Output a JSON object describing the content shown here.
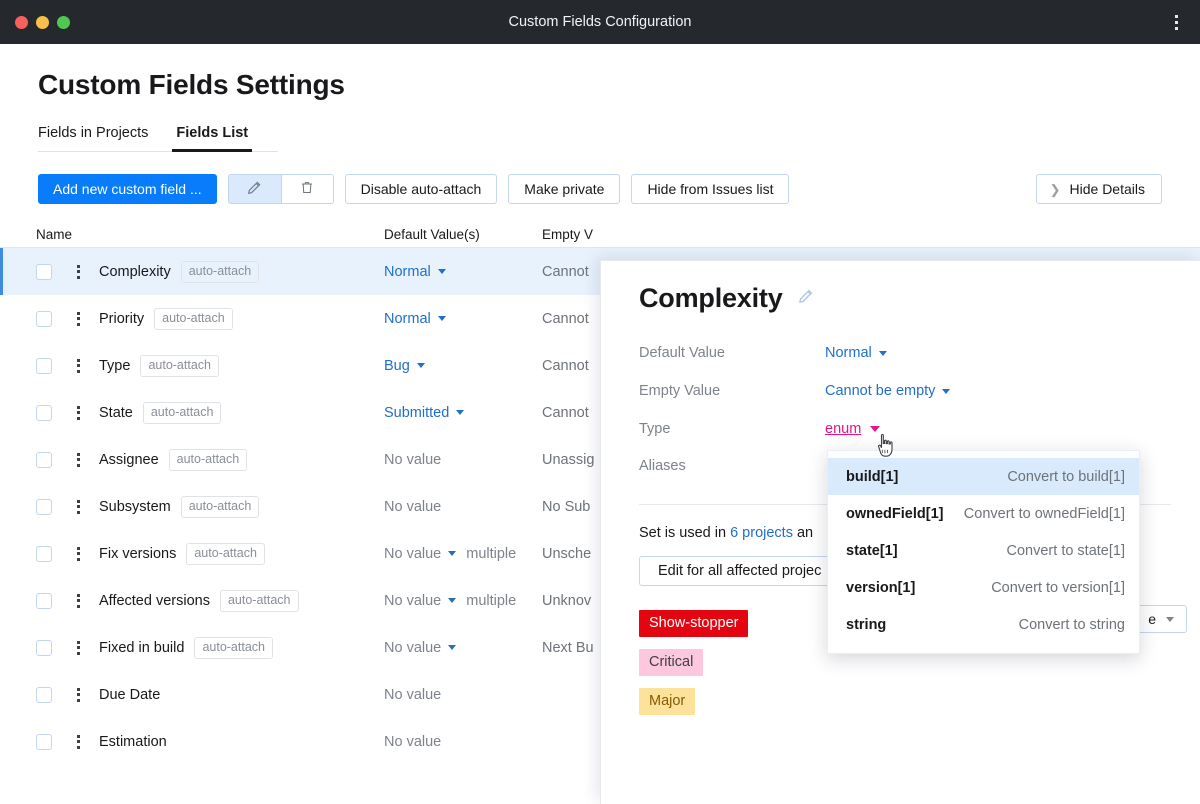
{
  "window": {
    "title": "Custom Fields Configuration",
    "menu_icon": "kebab-menu-icon"
  },
  "page": {
    "title": "Custom Fields Settings"
  },
  "tabs": [
    {
      "label": "Fields in Projects",
      "active": false
    },
    {
      "label": "Fields List",
      "active": true
    }
  ],
  "toolbar": {
    "add_label": "Add new custom field ...",
    "edit_icon": "pencil-icon",
    "delete_icon": "trash-icon",
    "disable_auto_attach_label": "Disable auto-attach",
    "make_private_label": "Make private",
    "hide_from_issues_label": "Hide from Issues list",
    "hide_details_label": "Hide Details",
    "hide_details_chevron": "chevron-right-icon"
  },
  "table": {
    "headers": {
      "name": "Name",
      "default": "Default Value(s)",
      "empty": "Empty V"
    },
    "chip_label": "auto-attach",
    "rows": [
      {
        "name": "Complexity",
        "chip": true,
        "default": "Normal",
        "default_link": true,
        "caret": true,
        "multiple": "",
        "empty": "Cannot",
        "selected": true
      },
      {
        "name": "Priority",
        "chip": true,
        "default": "Normal",
        "default_link": true,
        "caret": true,
        "multiple": "",
        "empty": "Cannot",
        "selected": false
      },
      {
        "name": "Type",
        "chip": true,
        "default": "Bug",
        "default_link": true,
        "caret": true,
        "multiple": "",
        "empty": "Cannot",
        "selected": false
      },
      {
        "name": "State",
        "chip": true,
        "default": "Submitted",
        "default_link": true,
        "caret": true,
        "multiple": "",
        "empty": "Cannot",
        "selected": false
      },
      {
        "name": "Assignee",
        "chip": true,
        "default": "No value",
        "default_link": false,
        "caret": false,
        "multiple": "",
        "empty": "Unassig",
        "selected": false
      },
      {
        "name": "Subsystem",
        "chip": true,
        "default": "No value",
        "default_link": false,
        "caret": false,
        "multiple": "",
        "empty": "No Sub",
        "selected": false
      },
      {
        "name": "Fix versions",
        "chip": true,
        "default": "No value",
        "default_link": false,
        "caret": true,
        "multiple": "multiple",
        "empty": "Unsche",
        "selected": false
      },
      {
        "name": "Affected versions",
        "chip": true,
        "default": "No value",
        "default_link": false,
        "caret": true,
        "multiple": "multiple",
        "empty": "Unknov",
        "selected": false
      },
      {
        "name": "Fixed in build",
        "chip": true,
        "default": "No value",
        "default_link": false,
        "caret": true,
        "multiple": "",
        "empty": "Next Bu",
        "selected": false
      },
      {
        "name": "Due Date",
        "chip": false,
        "default": "No value",
        "default_link": false,
        "caret": false,
        "multiple": "",
        "empty": "",
        "selected": false
      },
      {
        "name": "Estimation",
        "chip": false,
        "default": "No value",
        "default_link": false,
        "caret": false,
        "multiple": "",
        "empty": "",
        "selected": false
      }
    ]
  },
  "details": {
    "title": "Complexity",
    "edit_title_icon": "pencil-icon",
    "props": [
      {
        "label": "Default Value",
        "value": "Normal",
        "pink": false
      },
      {
        "label": "Empty Value",
        "value": "Cannot be empty",
        "pink": false
      },
      {
        "label": "Type",
        "value": "enum",
        "pink": true
      }
    ],
    "aliases_label": "Aliases",
    "used_in_prefix": "Set is used in ",
    "used_in_link": "6 projects",
    "used_in_suffix": " an",
    "edit_all_label": "Edit for all affected projec",
    "behind_select_value": "e",
    "tags": [
      {
        "label": "Show-stopper",
        "bg": "#e30611",
        "fg": "#ffffff"
      },
      {
        "label": "Critical",
        "bg": "#fdc8de",
        "fg": "#3c3f43"
      },
      {
        "label": "Major",
        "bg": "#fde29b",
        "fg": "#8a5a00"
      }
    ]
  },
  "dropdown": {
    "items": [
      {
        "left": "build[1]",
        "right": "Convert to build[1]",
        "highlight": true
      },
      {
        "left": "ownedField[1]",
        "right": "Convert to ownedField[1]",
        "highlight": false
      },
      {
        "left": "state[1]",
        "right": "Convert to state[1]",
        "highlight": false
      },
      {
        "left": "version[1]",
        "right": "Convert to version[1]",
        "highlight": false
      },
      {
        "left": "string",
        "right": "Convert to string",
        "highlight": false
      }
    ]
  },
  "colors": {
    "accent": "#087cfa",
    "link": "#1f6fcc",
    "pink": "#e8138c",
    "titlebar": "#25282c",
    "selected_row": "#e8f2fd"
  }
}
